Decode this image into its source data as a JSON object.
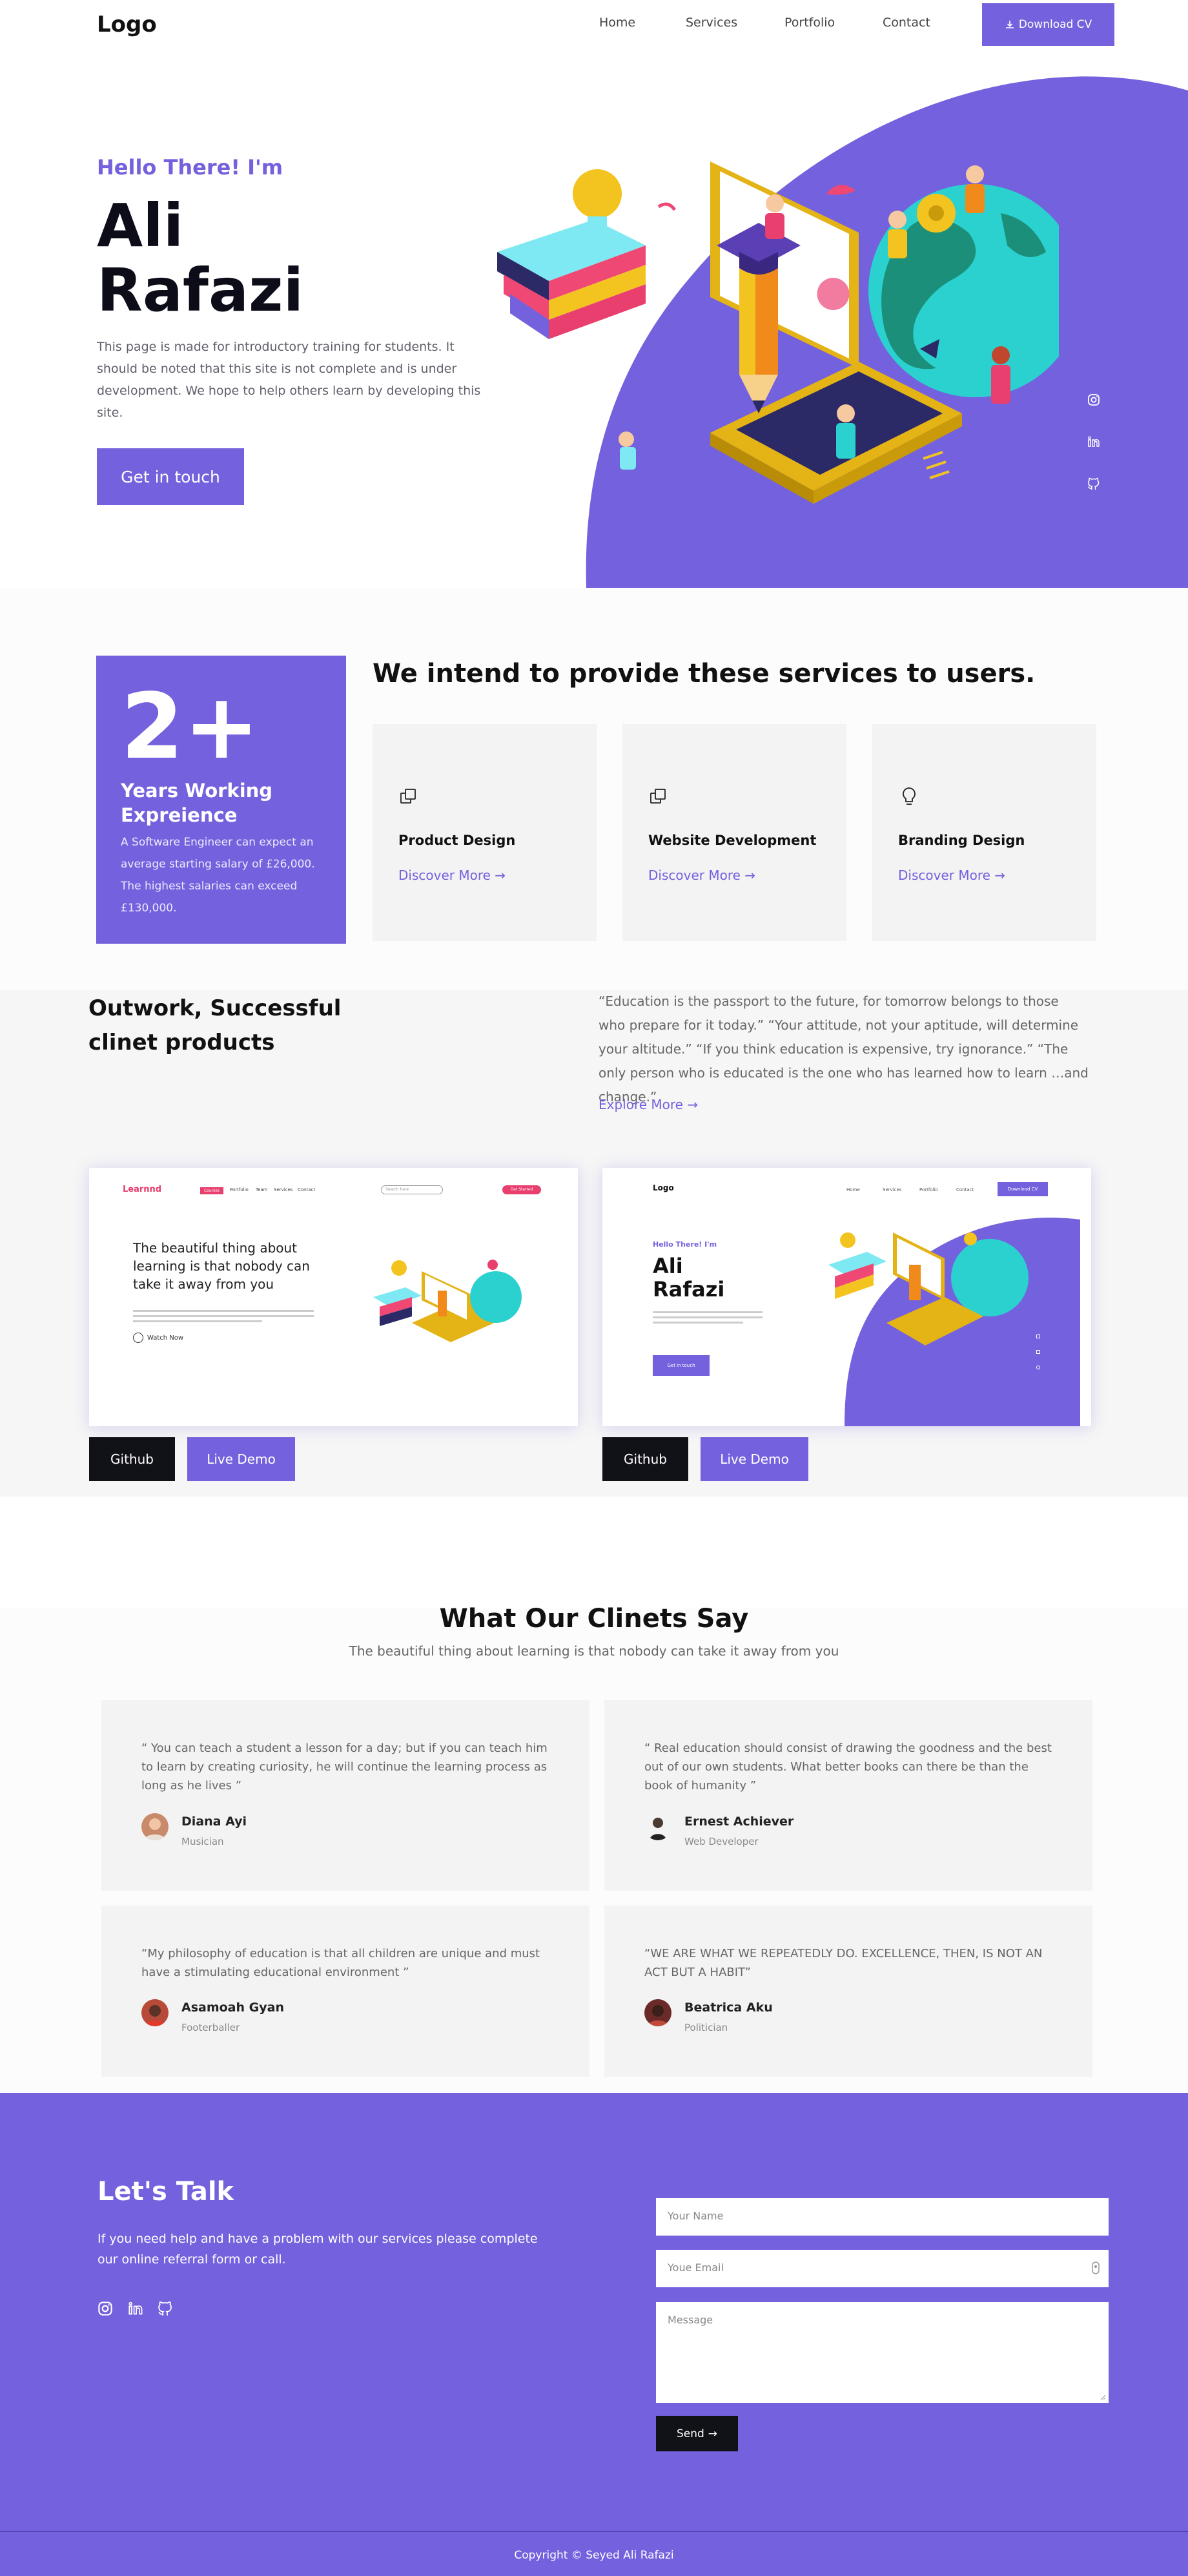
{
  "header": {
    "logo": "Logo",
    "nav": [
      "Home",
      "Services",
      "Portfolio",
      "Contact"
    ],
    "download_label": "Download CV"
  },
  "hero": {
    "greeting": "Hello There! I'm",
    "first_name": "Ali",
    "last_name": "Rafazi",
    "description": "This page is made for introductory training for students. It should be noted that this site is not complete and is under development. We hope to help others learn by developing this site.",
    "cta": "Get in touch",
    "social_icons": [
      "instagram-icon",
      "linkedin-icon",
      "github-icon"
    ]
  },
  "experience": {
    "number": "2+",
    "title": "Years Working Expreience",
    "text": "A Software Engineer can expect an average starting salary of £26,000. The highest salaries can exceed £130,000."
  },
  "services": {
    "heading": "We intend to provide these services to users.",
    "items": [
      {
        "title": "Product Design",
        "link": "Discover More",
        "icon": "layers-icon"
      },
      {
        "title": "Website Development",
        "link": "Discover More",
        "icon": "layers-icon"
      },
      {
        "title": "Branding Design",
        "link": "Discover More",
        "icon": "lightbulb-icon"
      }
    ]
  },
  "portfolio": {
    "title": "Outwork, Successful clinet products",
    "quote": "“Education is the passport to the future, for tomorrow belongs to those who prepare for it today.” “Your attitude, not your aptitude, will determine your altitude.” “If you think education is expensive, try ignorance.” “The only person who is educated is the one who has learned how to learn …and change.”",
    "explore": "Explore More",
    "github_label": "Github",
    "demo_label": "Live Demo",
    "shot1": {
      "logo": "Learnnd",
      "nav": [
        "Courses",
        "Portfolio",
        "Team",
        "Services",
        "Contact"
      ],
      "search": "Search here",
      "btn": "Get Started",
      "headline": "The beautiful thing about learning is that nobody can take it away from you",
      "watch": "Watch Now"
    },
    "shot2": {
      "logo": "Logo",
      "nav": [
        "Home",
        "Services",
        "Portfolio",
        "Contact"
      ],
      "btn": "Download CV",
      "hello": "Hello There! I'm",
      "name1": "Ali",
      "name2": "Rafazi",
      "cta": "Get in touch"
    }
  },
  "testimonials": {
    "heading": "What Our Clinets Say",
    "subheading": "The beautiful thing about learning is that nobody can take it away from you",
    "items": [
      {
        "quote": "“ You can teach a student a lesson for a day; but if you can teach him to learn by creating curiosity, he will continue the learning process as long as he lives ”",
        "name": "Diana Ayi",
        "role": "Musician"
      },
      {
        "quote": "“ Real education should consist of drawing the goodness and the best out of our own students. What better books can there be than the book of humanity ”",
        "name": "Ernest Achiever",
        "role": "Web Developer"
      },
      {
        "quote": "“My philosophy of education is that all children are unique and must have a stimulating educational environment ”",
        "name": "Asamoah Gyan",
        "role": "Footerballer"
      },
      {
        "quote": "“WE ARE WHAT WE REPEATEDLY DO. EXCELLENCE, THEN, IS NOT AN ACT BUT A HABIT”",
        "name": "Beatrica Aku",
        "role": "Politician"
      }
    ]
  },
  "contact": {
    "title": "Let's Talk",
    "text": "If you need help and have a problem with our services please complete our online referral form or call.",
    "name_placeholder": "Your Name",
    "email_placeholder": "Youe Email",
    "message_placeholder": "Message",
    "send_label": "Send"
  },
  "footer": {
    "copyright": "Copyright © Seyed Ali Rafazi"
  },
  "colors": {
    "accent": "#7461dd",
    "accent_dark": "#5b49c9",
    "dark": "#111118",
    "teal": "#2ad1cf",
    "yellow": "#f3c420"
  }
}
